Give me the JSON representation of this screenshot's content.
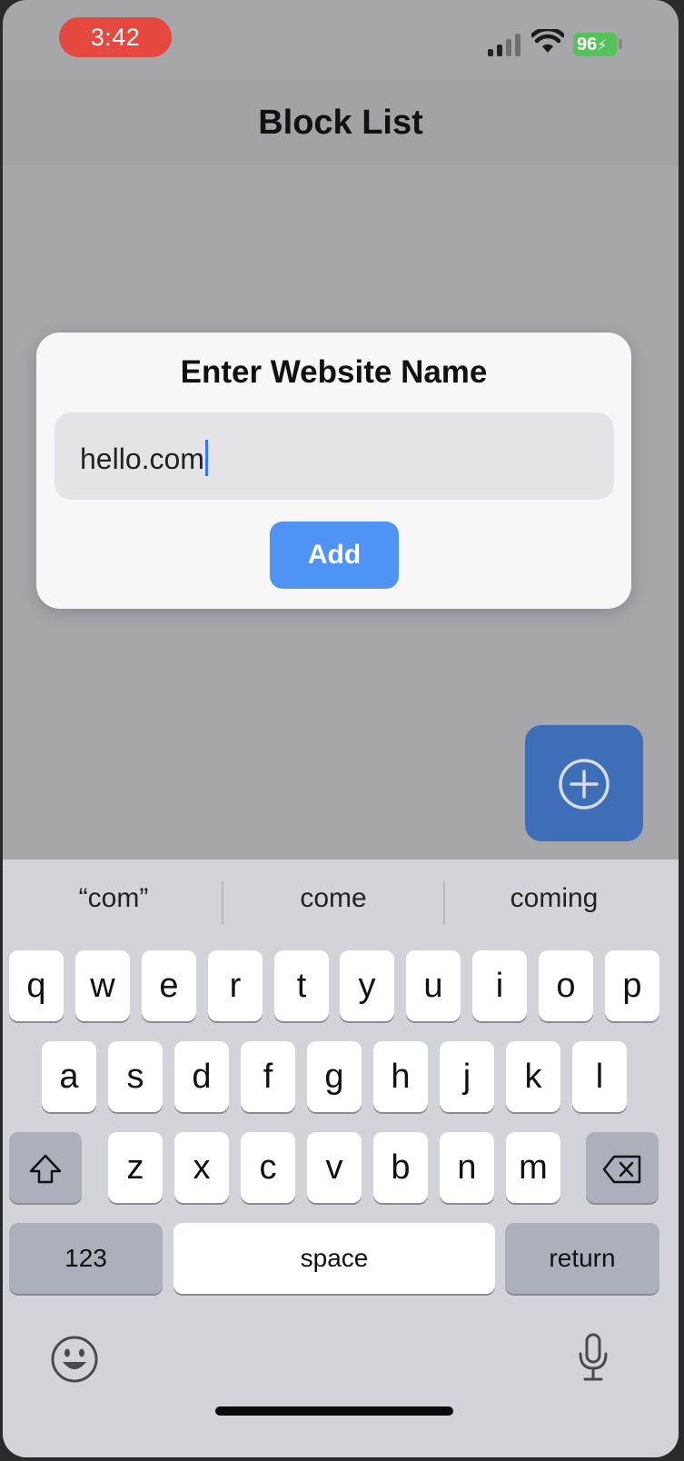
{
  "status_bar": {
    "time": "3:42",
    "battery": "96"
  },
  "nav": {
    "title": "Block List"
  },
  "dialog": {
    "title": "Enter Website Name",
    "input_value": "hello.com",
    "add_label": "Add"
  },
  "keyboard": {
    "suggestions": [
      "“com”",
      "come",
      "coming"
    ],
    "row1": [
      "q",
      "w",
      "e",
      "r",
      "t",
      "y",
      "u",
      "i",
      "o",
      "p"
    ],
    "row2": [
      "a",
      "s",
      "d",
      "f",
      "g",
      "h",
      "j",
      "k",
      "l"
    ],
    "row3": [
      "z",
      "x",
      "c",
      "v",
      "b",
      "n",
      "m"
    ],
    "numbers_label": "123",
    "space_label": "space",
    "return_label": "return"
  },
  "icons": {
    "fab": "plus-circle-icon",
    "shift": "shift-icon",
    "delete": "backspace-icon",
    "emoji": "emoji-icon",
    "mic": "microphone-icon"
  },
  "colors": {
    "accent": "#4f93f4",
    "fab": "#3f6eb8",
    "time_pill": "#e5483f",
    "battery": "#56c35a"
  }
}
